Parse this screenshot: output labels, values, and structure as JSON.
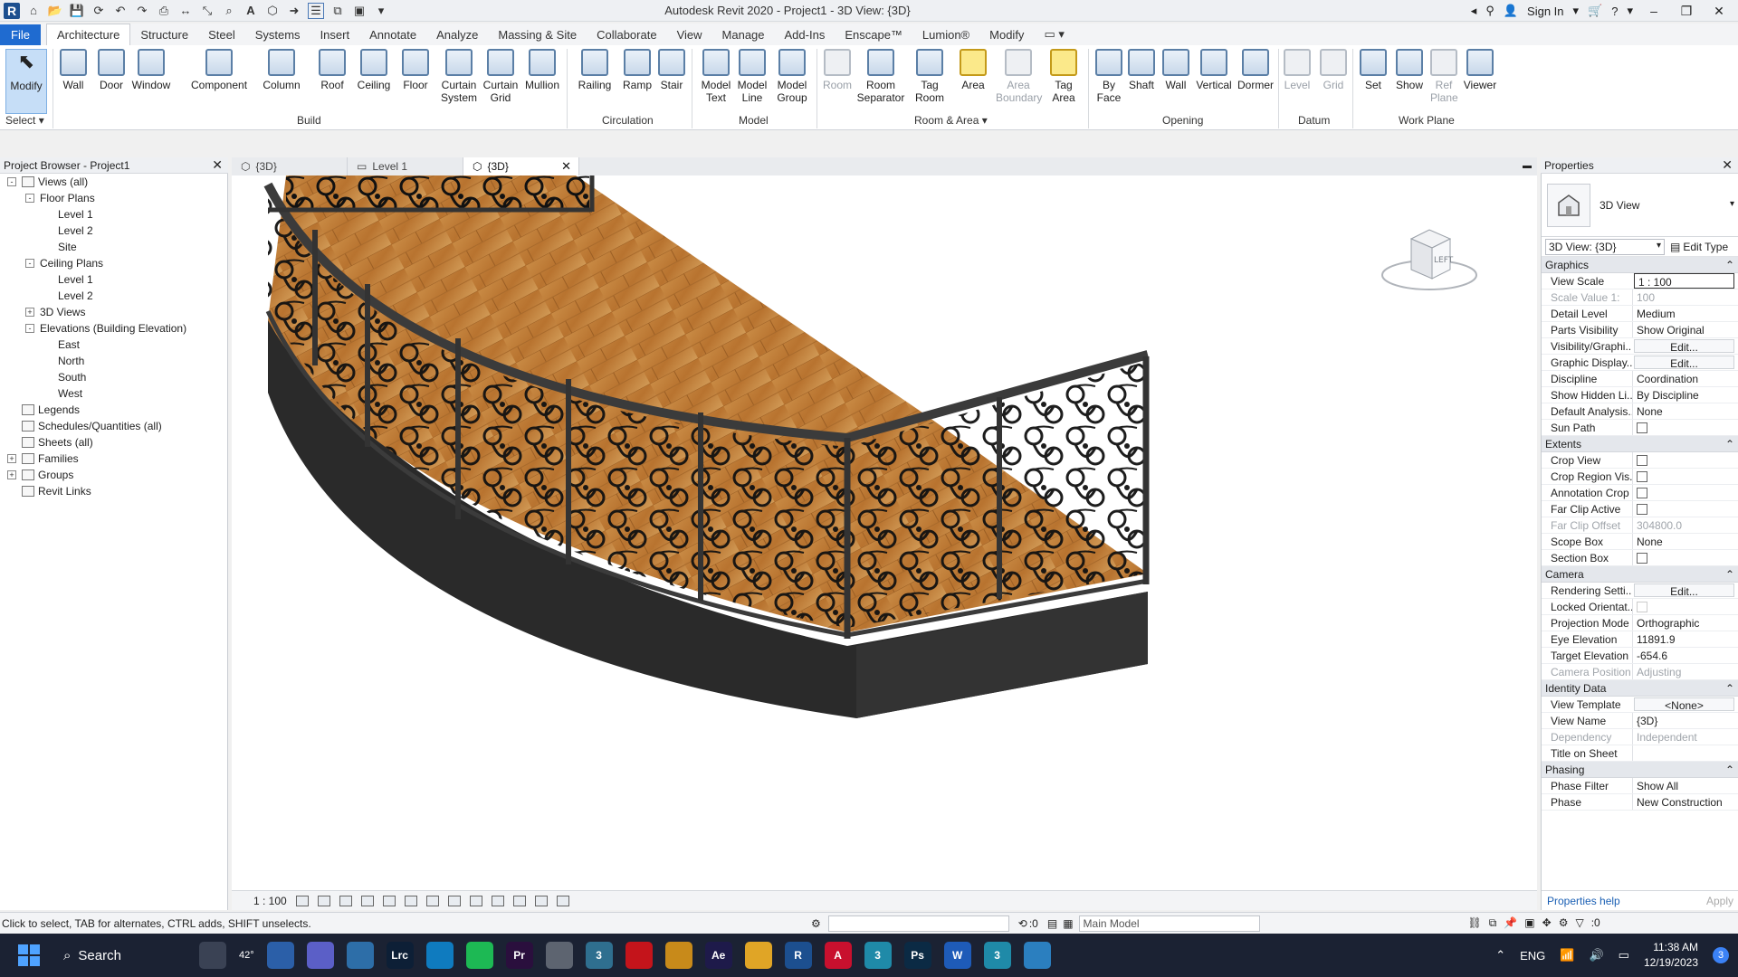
{
  "title": "Autodesk Revit 2020 - Project1 - 3D View: {3D}",
  "titlebar": {
    "sign_in": "Sign In"
  },
  "menu_tabs": [
    "File",
    "Architecture",
    "Structure",
    "Steel",
    "Systems",
    "Insert",
    "Annotate",
    "Analyze",
    "Massing & Site",
    "Collaborate",
    "View",
    "Manage",
    "Add-Ins",
    "Enscape™",
    "Lumion®",
    "Modify"
  ],
  "active_tab": "Architecture",
  "ribbon": {
    "modify": "Modify",
    "select": "Select",
    "tools": [
      {
        "id": "wall",
        "label": "Wall"
      },
      {
        "id": "door",
        "label": "Door"
      },
      {
        "id": "window",
        "label": "Window"
      },
      {
        "id": "component",
        "label": "Component"
      },
      {
        "id": "column",
        "label": "Column"
      },
      {
        "id": "roof",
        "label": "Roof"
      },
      {
        "id": "ceiling",
        "label": "Ceiling"
      },
      {
        "id": "floor",
        "label": "Floor"
      },
      {
        "id": "curtain-system",
        "label": "Curtain System"
      },
      {
        "id": "curtain-grid",
        "label": "Curtain Grid"
      },
      {
        "id": "mullion",
        "label": "Mullion"
      },
      {
        "id": "railing",
        "label": "Railing"
      },
      {
        "id": "ramp",
        "label": "Ramp"
      },
      {
        "id": "stair",
        "label": "Stair"
      },
      {
        "id": "model-text",
        "label": "Model Text"
      },
      {
        "id": "model-line",
        "label": "Model Line"
      },
      {
        "id": "model-group",
        "label": "Model Group"
      },
      {
        "id": "room",
        "label": "Room"
      },
      {
        "id": "room-separator",
        "label": "Room Separator"
      },
      {
        "id": "tag-room",
        "label": "Tag Room"
      },
      {
        "id": "area",
        "label": "Area"
      },
      {
        "id": "area-boundary",
        "label": "Area Boundary"
      },
      {
        "id": "tag-area",
        "label": "Tag Area"
      },
      {
        "id": "by-face",
        "label": "By Face"
      },
      {
        "id": "shaft",
        "label": "Shaft"
      },
      {
        "id": "wall-opening",
        "label": "Wall"
      },
      {
        "id": "vertical",
        "label": "Vertical"
      },
      {
        "id": "dormer",
        "label": "Dormer"
      },
      {
        "id": "level",
        "label": "Level"
      },
      {
        "id": "grid",
        "label": "Grid"
      },
      {
        "id": "set",
        "label": "Set"
      },
      {
        "id": "show",
        "label": "Show"
      },
      {
        "id": "ref-plane",
        "label": "Ref Plane"
      },
      {
        "id": "viewer",
        "label": "Viewer"
      }
    ],
    "panels": [
      "Build",
      "Circulation",
      "Model",
      "Room & Area",
      "Opening",
      "Datum",
      "Work Plane"
    ]
  },
  "project_browser": {
    "title": "Project Browser - Project1",
    "items": [
      {
        "label": "Views (all)",
        "depth": 0,
        "exp": "-"
      },
      {
        "label": "Floor Plans",
        "depth": 1,
        "exp": "-"
      },
      {
        "label": "Level 1",
        "depth": 2,
        "exp": ""
      },
      {
        "label": "Level 2",
        "depth": 2,
        "exp": ""
      },
      {
        "label": "Site",
        "depth": 2,
        "exp": ""
      },
      {
        "label": "Ceiling Plans",
        "depth": 1,
        "exp": "-"
      },
      {
        "label": "Level 1",
        "depth": 2,
        "exp": ""
      },
      {
        "label": "Level 2",
        "depth": 2,
        "exp": ""
      },
      {
        "label": "3D Views",
        "depth": 1,
        "exp": "+"
      },
      {
        "label": "Elevations (Building Elevation)",
        "depth": 1,
        "exp": "-"
      },
      {
        "label": "East",
        "depth": 2,
        "exp": ""
      },
      {
        "label": "North",
        "depth": 2,
        "exp": ""
      },
      {
        "label": "South",
        "depth": 2,
        "exp": ""
      },
      {
        "label": "West",
        "depth": 2,
        "exp": ""
      },
      {
        "label": "Legends",
        "depth": 0,
        "exp": ""
      },
      {
        "label": "Schedules/Quantities (all)",
        "depth": 0,
        "exp": ""
      },
      {
        "label": "Sheets (all)",
        "depth": 0,
        "exp": ""
      },
      {
        "label": "Families",
        "depth": 0,
        "exp": "+"
      },
      {
        "label": "Groups",
        "depth": 0,
        "exp": "+"
      },
      {
        "label": "Revit Links",
        "depth": 0,
        "exp": ""
      }
    ]
  },
  "view_tabs": [
    {
      "label": "{3D}",
      "active": false
    },
    {
      "label": "Level 1",
      "active": false
    },
    {
      "label": "{3D}",
      "active": true
    }
  ],
  "viewcube_label": "LEFT",
  "view_control": {
    "scale": "1 : 100"
  },
  "properties": {
    "title": "Properties",
    "type_name": "3D View",
    "instance_selector": "3D View: {3D}",
    "edit_type": "Edit Type",
    "sections": [
      {
        "name": "Graphics",
        "rows": [
          {
            "k": "View Scale",
            "v": "1 : 100",
            "style": "boxed"
          },
          {
            "k": "Scale Value    1:",
            "v": "100",
            "style": "dim"
          },
          {
            "k": "Detail Level",
            "v": "Medium"
          },
          {
            "k": "Parts Visibility",
            "v": "Show Original"
          },
          {
            "k": "Visibility/Graphi...",
            "v": "Edit...",
            "style": "btn"
          },
          {
            "k": "Graphic Display...",
            "v": "Edit...",
            "style": "btn"
          },
          {
            "k": "Discipline",
            "v": "Coordination"
          },
          {
            "k": "Show Hidden Li...",
            "v": "By Discipline"
          },
          {
            "k": "Default Analysis...",
            "v": "None"
          },
          {
            "k": "Sun Path",
            "v": "",
            "style": "check"
          }
        ]
      },
      {
        "name": "Extents",
        "rows": [
          {
            "k": "Crop View",
            "v": "",
            "style": "check"
          },
          {
            "k": "Crop Region Vis...",
            "v": "",
            "style": "check"
          },
          {
            "k": "Annotation Crop",
            "v": "",
            "style": "check"
          },
          {
            "k": "Far Clip Active",
            "v": "",
            "style": "check"
          },
          {
            "k": "Far Clip Offset",
            "v": "304800.0",
            "style": "dim"
          },
          {
            "k": "Scope Box",
            "v": "None"
          },
          {
            "k": "Section Box",
            "v": "",
            "style": "check"
          }
        ]
      },
      {
        "name": "Camera",
        "rows": [
          {
            "k": "Rendering Setti...",
            "v": "Edit...",
            "style": "btn"
          },
          {
            "k": "Locked Orientat...",
            "v": "",
            "style": "checkdim"
          },
          {
            "k": "Projection Mode",
            "v": "Orthographic"
          },
          {
            "k": "Eye Elevation",
            "v": "11891.9"
          },
          {
            "k": "Target Elevation",
            "v": "-654.6"
          },
          {
            "k": "Camera Position",
            "v": "Adjusting",
            "style": "dim"
          }
        ]
      },
      {
        "name": "Identity Data",
        "rows": [
          {
            "k": "View Template",
            "v": "<None>",
            "style": "btn"
          },
          {
            "k": "View Name",
            "v": "{3D}"
          },
          {
            "k": "Dependency",
            "v": "Independent",
            "style": "dim"
          },
          {
            "k": "Title on Sheet",
            "v": ""
          }
        ]
      },
      {
        "name": "Phasing",
        "rows": [
          {
            "k": "Phase Filter",
            "v": "Show All"
          },
          {
            "k": "Phase",
            "v": "New Construction"
          }
        ]
      }
    ],
    "help_link": "Properties help",
    "apply": "Apply"
  },
  "statusbar": {
    "text": "Click to select, TAB for alternates, CTRL adds, SHIFT unselects.",
    "counter": ":0",
    "model": "Main Model",
    "filter_count": ":0"
  },
  "taskbar": {
    "search": "Search",
    "weather": "42°",
    "lang": "ENG",
    "time": "11:38 AM",
    "date": "12/19/2023",
    "notifications": "3",
    "apps": [
      {
        "name": "task-view",
        "label": "",
        "color": "#3a4254"
      },
      {
        "name": "weather",
        "label": "",
        "color": "#2b5fa8"
      },
      {
        "name": "teams",
        "label": "",
        "color": "#5b5fc7"
      },
      {
        "name": "photos",
        "label": "",
        "color": "#2d6ea8"
      },
      {
        "name": "lightroom",
        "label": "Lrc",
        "color": "#0d1f36"
      },
      {
        "name": "edge",
        "label": "",
        "color": "#0f7bbf"
      },
      {
        "name": "spotify",
        "label": "",
        "color": "#1db954"
      },
      {
        "name": "premiere",
        "label": "Pr",
        "color": "#2a0f3d"
      },
      {
        "name": "app-gray",
        "label": "",
        "color": "#5d6470"
      },
      {
        "name": "app-3",
        "label": "3",
        "color": "#2f6f8f"
      },
      {
        "name": "opera",
        "label": "",
        "color": "#c4141b"
      },
      {
        "name": "media",
        "label": "",
        "color": "#c88a1a"
      },
      {
        "name": "after-effects",
        "label": "Ae",
        "color": "#1e1a4a"
      },
      {
        "name": "file-explorer",
        "label": "",
        "color": "#e0a526"
      },
      {
        "name": "revit",
        "label": "R",
        "color": "#1c4f8f"
      },
      {
        "name": "autocad",
        "label": "A",
        "color": "#c8102e"
      },
      {
        "name": "3dsmax-1",
        "label": "3",
        "color": "#1f8aa8"
      },
      {
        "name": "photoshop",
        "label": "Ps",
        "color": "#0b2a44"
      },
      {
        "name": "word",
        "label": "W",
        "color": "#1e5bb8"
      },
      {
        "name": "3dsmax-2",
        "label": "3",
        "color": "#1f8aa8"
      },
      {
        "name": "globe-app",
        "label": "",
        "color": "#2b7fbf"
      }
    ]
  }
}
